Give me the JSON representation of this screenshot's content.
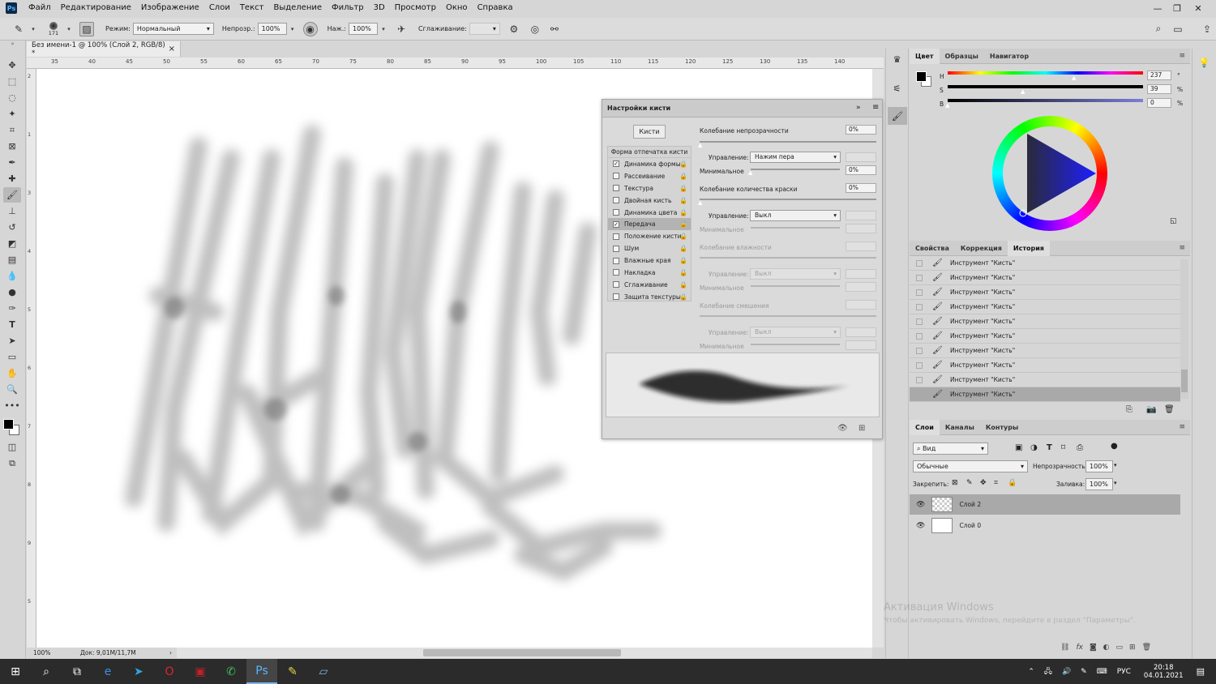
{
  "app": {
    "logo": "Ps",
    "menu": [
      "Файл",
      "Редактирование",
      "Изображение",
      "Слои",
      "Текст",
      "Выделение",
      "Фильтр",
      "3D",
      "Просмотр",
      "Окно",
      "Справка"
    ],
    "window_controls": [
      "minimize-icon",
      "restore-icon",
      "close-icon"
    ]
  },
  "options": {
    "brush_size": "171",
    "mode_label": "Режим:",
    "mode_value": "Нормальный",
    "opacity_label": "Непрозр.:",
    "opacity_value": "100%",
    "pressure_label": "Наж.:",
    "pressure_value": "100%",
    "smoothing_label": "Сглаживание:",
    "smoothing_value": ""
  },
  "document": {
    "tab_title": "Без имени-1 @ 100% (Слой 2, RGB/8) *",
    "tab_close": "×",
    "zoom": "100%",
    "doc_size": "Док: 9,01M/11,7M"
  },
  "ruler": {
    "h_ticks": [
      "35",
      "40",
      "45",
      "50",
      "55",
      "60",
      "65",
      "70",
      "75",
      "80",
      "85",
      "90",
      "95",
      "100",
      "105",
      "110",
      "115",
      "120",
      "125",
      "130",
      "135",
      "140"
    ],
    "v_ticks": [
      "2",
      "1",
      "3",
      "4",
      "5",
      "6",
      "7",
      "8",
      "9",
      "5"
    ]
  },
  "brush_panel": {
    "title": "Настройки кисти",
    "brushes_button": "Кисти",
    "brush_tip_label": "Форма отпечатка кисти",
    "options": [
      {
        "label": "Динамика формы",
        "checked": true,
        "active": false
      },
      {
        "label": "Рассеивание",
        "checked": false,
        "active": false
      },
      {
        "label": "Текстура",
        "checked": false,
        "active": false
      },
      {
        "label": "Двойная кисть",
        "checked": false,
        "active": false
      },
      {
        "label": "Динамика цвета",
        "checked": false,
        "active": false
      },
      {
        "label": "Передача",
        "checked": true,
        "active": true
      },
      {
        "label": "Положение кисти",
        "checked": false,
        "active": false
      },
      {
        "label": "Шум",
        "checked": false,
        "active": false
      },
      {
        "label": "Влажные края",
        "checked": false,
        "active": false
      },
      {
        "label": "Накладка",
        "checked": false,
        "active": false
      },
      {
        "label": "Сглаживание",
        "checked": false,
        "active": false
      },
      {
        "label": "Защита текстуры",
        "checked": false,
        "active": false
      }
    ],
    "opacity_jitter_label": "Колебание непрозрачности",
    "opacity_jitter_value": "0%",
    "control_label": "Управление:",
    "control1_value": "Нажим пера",
    "min_label": "Минимальное",
    "min1_value": "0%",
    "flow_jitter_label": "Колебание количества краски",
    "flow_jitter_value": "0%",
    "control2_value": "Выкл",
    "wetness_label": "Колебание влажности",
    "control3_value": "Выкл",
    "mix_label": "Колебание смешения",
    "control4_value": "Выкл"
  },
  "color_panel": {
    "tabs": [
      "Цвет",
      "Образцы",
      "Навигатор"
    ],
    "h_label": "H",
    "h_value": "237",
    "h_unit": "°",
    "s_label": "S",
    "s_value": "39",
    "s_unit": "%",
    "b_label": "B",
    "b_value": "0",
    "b_unit": "%",
    "foreground": "#000000",
    "background": "#ffffff"
  },
  "history_panel": {
    "tabs": [
      "Свойства",
      "Коррекция",
      "История"
    ],
    "items": [
      "Инструмент \"Кисть\"",
      "Инструмент \"Кисть\"",
      "Инструмент \"Кисть\"",
      "Инструмент \"Кисть\"",
      "Инструмент \"Кисть\"",
      "Инструмент \"Кисть\"",
      "Инструмент \"Кисть\"",
      "Инструмент \"Кисть\"",
      "Инструмент \"Кисть\"",
      "Инструмент \"Кисть\""
    ]
  },
  "layers_panel": {
    "tabs": [
      "Слои",
      "Каналы",
      "Контуры"
    ],
    "filter_value": "Вид",
    "blend_mode": "Обычные",
    "opacity_label": "Непрозрачность:",
    "opacity_value": "100%",
    "lock_label": "Закрепить:",
    "fill_label": "Заливка:",
    "fill_value": "100%",
    "layers": [
      {
        "name": "Слой 2",
        "active": true,
        "transparent": true
      },
      {
        "name": "Слой 0",
        "active": false,
        "transparent": false
      }
    ]
  },
  "watermark": {
    "line1": "Активация Windows",
    "line2": "Чтобы активировать Windows, перейдите в раздел \"Параметры\"."
  },
  "taskbar": {
    "lang": "РУС",
    "time": "20:18",
    "date": "04.01.2021"
  }
}
